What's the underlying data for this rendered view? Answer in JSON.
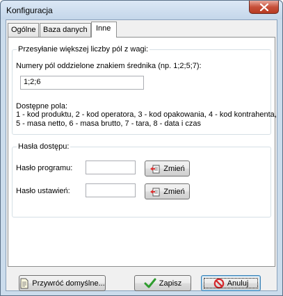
{
  "window": {
    "title": "Konfiguracja",
    "close_icon": "close-icon"
  },
  "tabs": [
    {
      "label": "Ogólne",
      "active": false
    },
    {
      "label": "Baza danych",
      "active": false
    },
    {
      "label": "Inne",
      "active": true
    }
  ],
  "multi_fields_group": {
    "legend": "Przesyłanie większej liczby pól z wagi:",
    "field_label": "Numery pól oddzielone znakiem średnika (np. 1;2;5;7):",
    "field_value": "1;2;6",
    "available_title": "Dostępne pola:",
    "available_line1": "1 - kod produktu, 2 - kod operatora, 3 - kod opakowania, 4 - kod kontrahenta,",
    "available_line2": "5 - masa netto, 6 - masa brutto, 7 - tara, 8 - data i czas"
  },
  "passwords_group": {
    "legend": "Hasła dostępu:",
    "program_label": "Hasło programu:",
    "program_value": "",
    "program_button": "Zmień",
    "settings_label": "Hasło ustawień:",
    "settings_value": "",
    "settings_button": "Zmień"
  },
  "footer": {
    "restore_button": "Przywróć domyślne...",
    "save_button": "Zapisz",
    "cancel_button": "Anuluj"
  },
  "colors": {
    "title_bar": "#c4d6ea",
    "close_button": "#c7503a",
    "save_check": "#2e9c2e",
    "cancel_icon": "#d4262a"
  }
}
